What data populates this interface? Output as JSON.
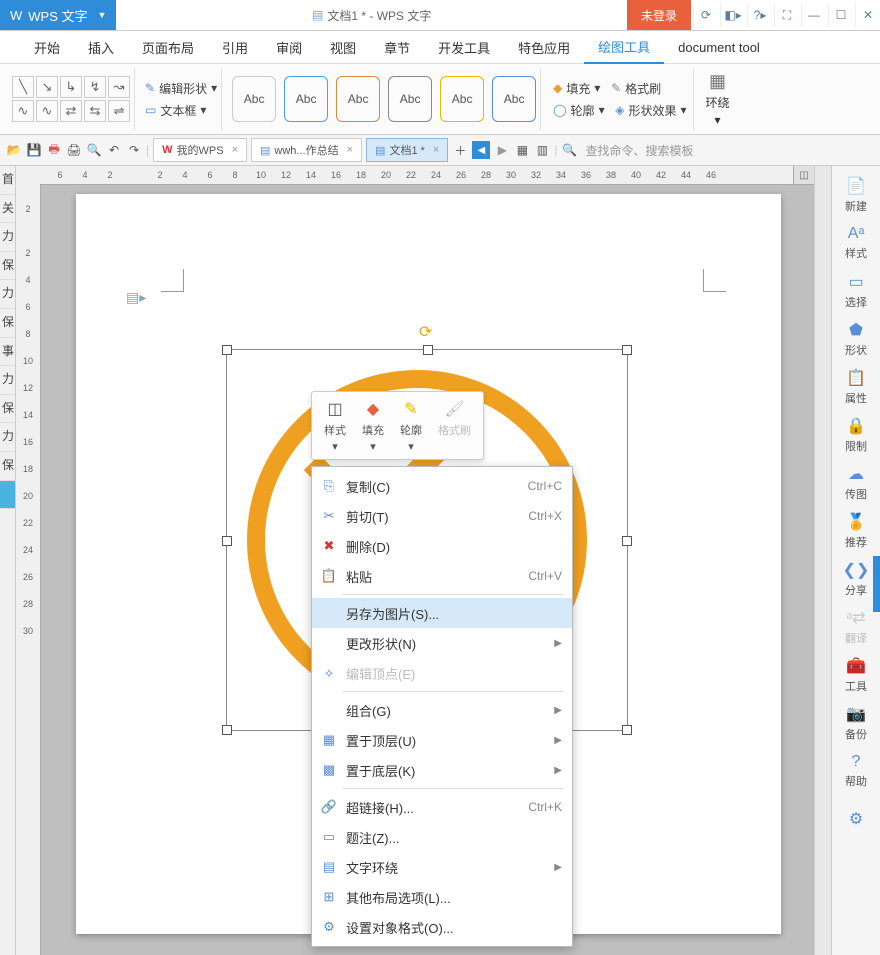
{
  "title": {
    "badge": "WPS 文字",
    "doc": "文档1 * - WPS 文字",
    "login": "未登录"
  },
  "menu": [
    "开始",
    "插入",
    "页面布局",
    "引用",
    "审阅",
    "视图",
    "章节",
    "开发工具",
    "特色应用",
    "绘图工具",
    "document tool"
  ],
  "menu_active": 9,
  "ribbon": {
    "edit_shape": "编辑形状",
    "textbox": "文本框",
    "abc": "Abc",
    "fill": "填充",
    "fmt": "格式刷",
    "outline": "轮廓",
    "effect": "形状效果",
    "wrap": "环绕"
  },
  "tabs": {
    "t1": "我的WPS",
    "t2": "wwh...作总结",
    "t3": "文档1 *",
    "search": "查找命令、搜索模板"
  },
  "ruler_h": [
    "6",
    "4",
    "2",
    "",
    "2",
    "4",
    "6",
    "8",
    "10",
    "12",
    "14",
    "16",
    "18",
    "20",
    "22",
    "24",
    "26",
    "28",
    "30",
    "32",
    "34",
    "36",
    "38",
    "40",
    "42",
    "44",
    "46"
  ],
  "ruler_v": [
    "2",
    "",
    "2",
    "4",
    "6",
    "8",
    "10",
    "12",
    "14",
    "16",
    "18",
    "20",
    "22",
    "24",
    "26",
    "28",
    "30"
  ],
  "mini": {
    "style": "样式",
    "fill": "填充",
    "outline": "轮廓",
    "fmt": "格式刷"
  },
  "ctx": {
    "copy": "复制(C)",
    "cut": "剪切(T)",
    "del": "删除(D)",
    "paste": "粘贴",
    "saveimg": "另存为图片(S)...",
    "chshape": "更改形状(N)",
    "editpt": "编辑顶点(E)",
    "group": "组合(G)",
    "front": "置于顶层(U)",
    "back": "置于底层(K)",
    "link": "超链接(H)...",
    "caption": "题注(Z)...",
    "wrap": "文字环绕",
    "layout": "其他布局选项(L)...",
    "fmtobj": "设置对象格式(O)...",
    "sc_copy": "Ctrl+C",
    "sc_cut": "Ctrl+X",
    "sc_paste": "Ctrl+V",
    "sc_link": "Ctrl+K"
  },
  "rp": [
    "新建",
    "样式",
    "选择",
    "形状",
    "属性",
    "限制",
    "传图",
    "推荐",
    "分享",
    "翻译",
    "工具",
    "备份",
    "帮助"
  ],
  "left": [
    "首",
    "关",
    "力",
    "保",
    "",
    "力",
    "保",
    "",
    "事",
    "",
    "力",
    "保",
    "",
    "力",
    "保",
    ""
  ]
}
